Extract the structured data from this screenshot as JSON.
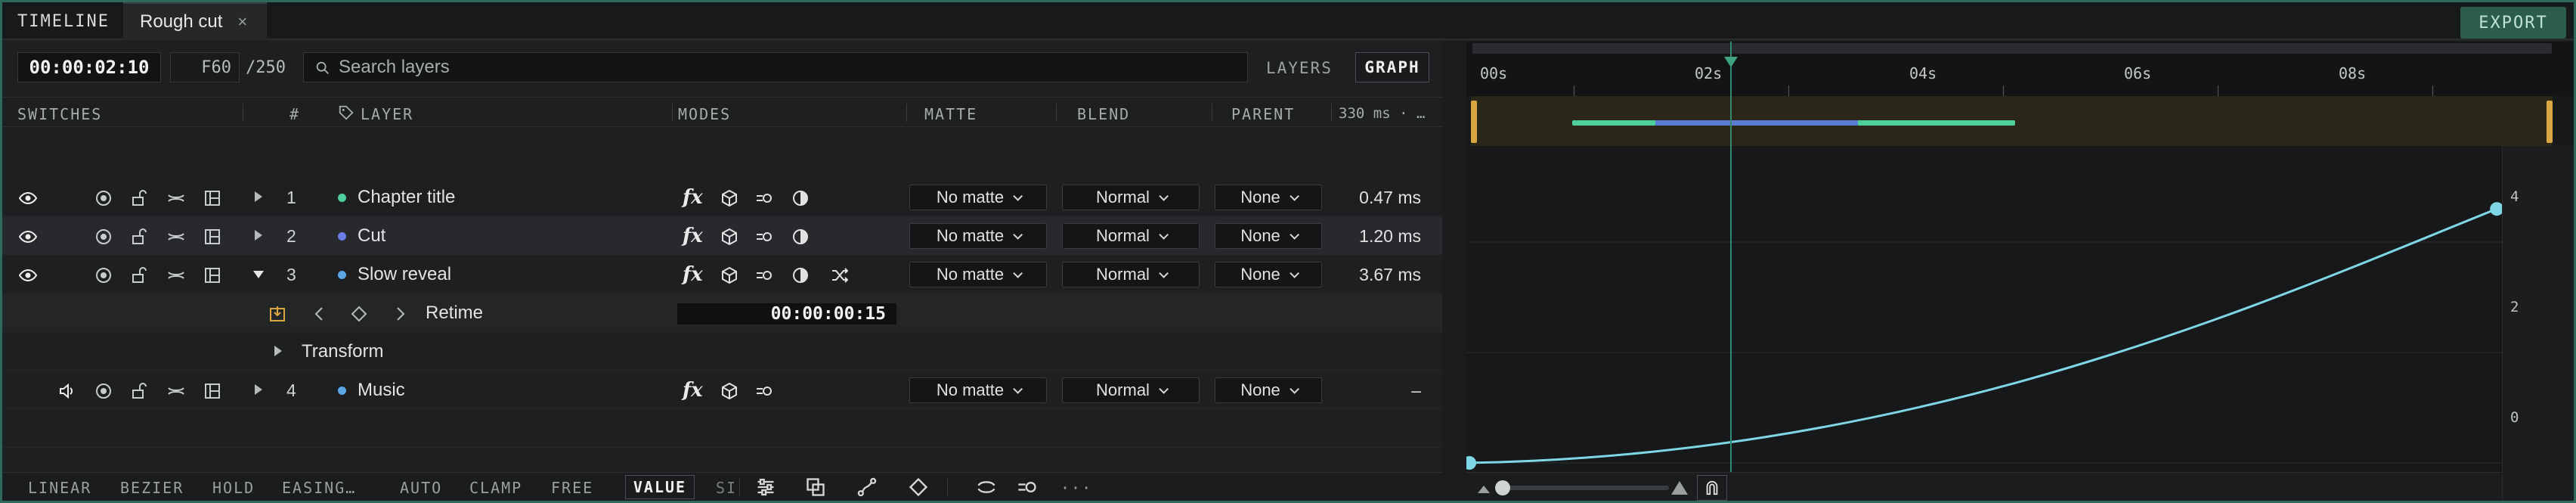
{
  "tabs": {
    "panel_label": "TIMELINE",
    "document_tab": "Rough cut",
    "close_glyph": "×"
  },
  "export_label": "EXPORT",
  "toolbar": {
    "timecode": "00:00:02:10",
    "fps": "F60",
    "total_frames": "/250",
    "search_placeholder": "Search layers",
    "view_layers": "LAYERS",
    "view_graph": "GRAPH",
    "active_view": "GRAPH"
  },
  "columns": {
    "switches": "SWITCHES",
    "index": "#",
    "layer": "LAYER",
    "modes": "MODES",
    "matte": "MATTE",
    "blend": "BLEND",
    "parent": "PARENT",
    "timing": "330 ms · …"
  },
  "layers": [
    {
      "index": "1",
      "name": "Chapter title",
      "color": "#4fcf9c",
      "matte": "No matte",
      "blend": "Normal",
      "parent": "None",
      "time": "0.47 ms",
      "expanded": false,
      "selected": false,
      "av_icon": "eye-icon"
    },
    {
      "index": "2",
      "name": "Cut",
      "color": "#6a7ee6",
      "matte": "No matte",
      "blend": "Normal",
      "parent": "None",
      "time": "1.20 ms",
      "expanded": false,
      "selected": true,
      "av_icon": "eye-icon"
    },
    {
      "index": "3",
      "name": "Slow reveal",
      "color": "#5aa7e6",
      "matte": "No matte",
      "blend": "Normal",
      "parent": "None",
      "time": "3.67 ms",
      "expanded": true,
      "selected": false,
      "av_icon": "eye-icon"
    },
    {
      "index": "4",
      "name": "Music",
      "color": "#5aa7e6",
      "matte": "No matte",
      "blend": "Normal",
      "parent": "None",
      "time": "–",
      "expanded": false,
      "selected": false,
      "av_icon": "speaker-icon"
    }
  ],
  "retime": {
    "label": "Retime",
    "value": "00:00:00:15"
  },
  "transform_label": "Transform",
  "interpolation": {
    "linear": "LINEAR",
    "bezier": "BEZIER",
    "hold": "HOLD",
    "easing": "EASING…",
    "auto": "AUTO",
    "clamp": "CLAMP",
    "free": "FREE",
    "value": "VALUE",
    "speed_truncated": "SI",
    "more": "···"
  },
  "graph": {
    "x_ticks": [
      "00s",
      "02s",
      "04s",
      "06s",
      "08s"
    ],
    "y_ticks": [
      "4",
      "2",
      "0"
    ],
    "curve_start": {
      "t": 0,
      "v": 0
    },
    "curve_end": {
      "t": 9.6,
      "v": 4.6
    },
    "accent": "#7fd7e6",
    "playhead_time": "02s"
  },
  "colors": {
    "accent_green": "#2f8a6f",
    "export_bg": "#2c5c4e",
    "workarea_handle": "#d9a640"
  }
}
